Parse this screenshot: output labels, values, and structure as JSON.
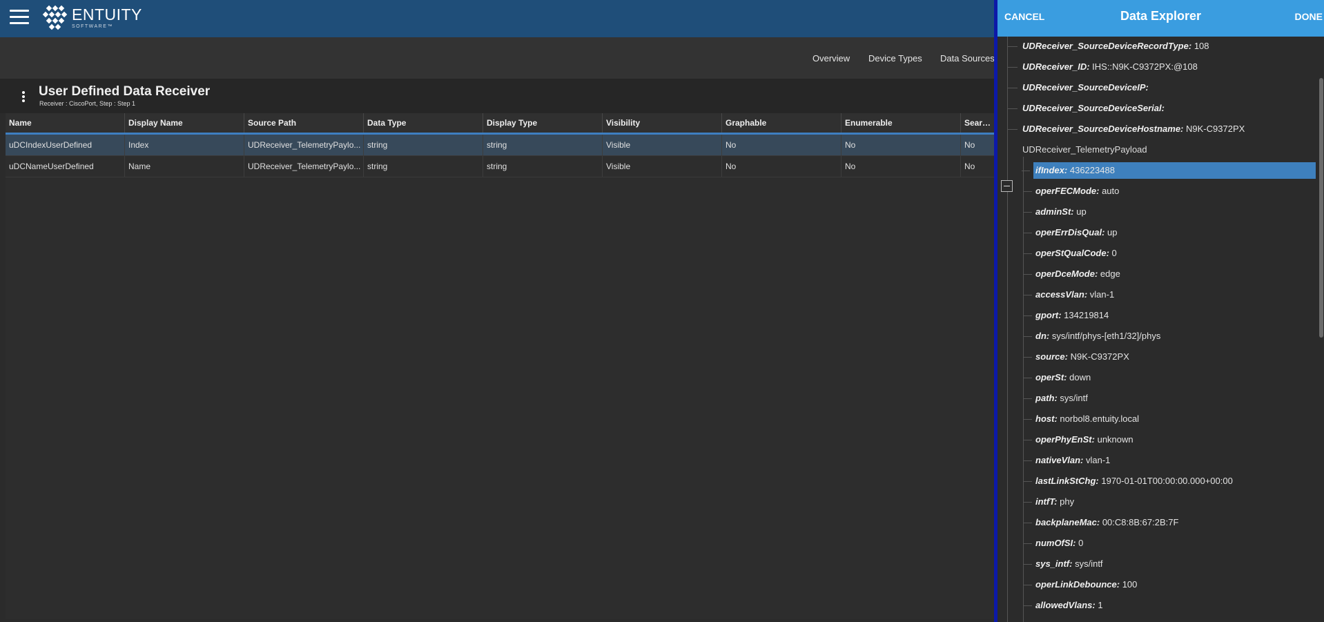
{
  "app": {
    "brand_name": "ENTUITY",
    "brand_sub": "SOFTWARE™",
    "colors": {
      "topbar": "#1f4e79",
      "drawer_header": "#3a9de0",
      "selection": "#3e80bd",
      "row_selected": "#37495a"
    }
  },
  "nav": {
    "links": [
      "Overview",
      "Device Types",
      "Data Sources"
    ]
  },
  "page": {
    "title": "User Defined Data Receiver",
    "subtitle": "Receiver : CiscoPort, Step : Step 1"
  },
  "grid": {
    "columns": [
      "Name",
      "Display Name",
      "Source Path",
      "Data Type",
      "Display Type",
      "Visibility",
      "Graphable",
      "Enumerable",
      "Searcha"
    ],
    "rows": [
      {
        "cells": [
          "uDCIndexUserDefined",
          "Index",
          "UDReceiver_TelemetryPaylo...",
          "string",
          "string",
          "Visible",
          "No",
          "No",
          "No"
        ]
      },
      {
        "cells": [
          "uDCNameUserDefined",
          "Name",
          "UDReceiver_TelemetryPaylo...",
          "string",
          "string",
          "Visible",
          "No",
          "No",
          "No"
        ]
      }
    ]
  },
  "drawer": {
    "cancel_label": "CANCEL",
    "title": "Data Explorer",
    "done_label": "DONE",
    "top_nodes": [
      {
        "key": "UDReceiver_SourceDeviceRecordType:",
        "value": "108"
      },
      {
        "key": "UDReceiver_ID:",
        "value": "IHS::N9K-C9372PX:@108"
      },
      {
        "key": "UDReceiver_SourceDeviceIP:",
        "value": ""
      },
      {
        "key": "UDReceiver_SourceDeviceSerial:",
        "value": ""
      },
      {
        "key": "UDReceiver_SourceDeviceHostname:",
        "value": "N9K-C9372PX"
      }
    ],
    "group_node": "UDReceiver_TelemetryPayload",
    "child_nodes": [
      {
        "key": "ifIndex:",
        "value": "436223488"
      },
      {
        "key": "operFECMode:",
        "value": "auto"
      },
      {
        "key": "adminSt:",
        "value": "up"
      },
      {
        "key": "operErrDisQual:",
        "value": "up"
      },
      {
        "key": "operStQualCode:",
        "value": "0"
      },
      {
        "key": "operDceMode:",
        "value": "edge"
      },
      {
        "key": "accessVlan:",
        "value": "vlan-1"
      },
      {
        "key": "gport:",
        "value": "134219814"
      },
      {
        "key": "dn:",
        "value": "sys/intf/phys-[eth1/32]/phys"
      },
      {
        "key": "source:",
        "value": "N9K-C9372PX"
      },
      {
        "key": "operSt:",
        "value": "down"
      },
      {
        "key": "path:",
        "value": "sys/intf"
      },
      {
        "key": "host:",
        "value": "norbol8.entuity.local"
      },
      {
        "key": "operPhyEnSt:",
        "value": "unknown"
      },
      {
        "key": "nativeVlan:",
        "value": "vlan-1"
      },
      {
        "key": "lastLinkStChg:",
        "value": "1970-01-01T00:00:00.000+00:00"
      },
      {
        "key": "intfT:",
        "value": "phy"
      },
      {
        "key": "backplaneMac:",
        "value": "00:C8:8B:67:2B:7F"
      },
      {
        "key": "numOfSI:",
        "value": "0"
      },
      {
        "key": "sys_intf:",
        "value": "sys/intf"
      },
      {
        "key": "operLinkDebounce:",
        "value": "100"
      },
      {
        "key": "allowedVlans:",
        "value": "1"
      }
    ]
  }
}
